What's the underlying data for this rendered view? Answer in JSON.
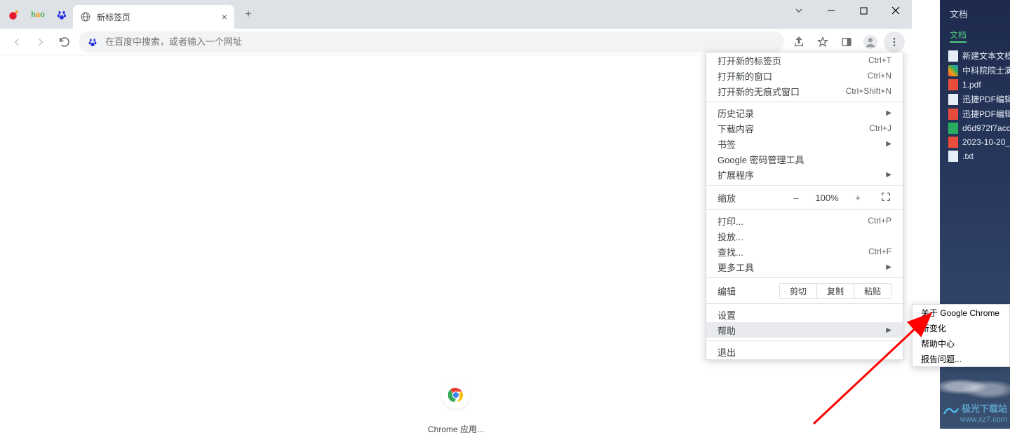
{
  "tab": {
    "title": "新标签页"
  },
  "omnibox": {
    "placeholder": "在百度中搜索，或者输入一个网址"
  },
  "content": {
    "apps_label": "Chrome 应用..."
  },
  "menu": {
    "new_tab": {
      "label": "打开新的标签页",
      "shortcut": "Ctrl+T"
    },
    "new_window": {
      "label": "打开新的窗口",
      "shortcut": "Ctrl+N"
    },
    "incognito": {
      "label": "打开新的无痕式窗口",
      "shortcut": "Ctrl+Shift+N"
    },
    "history": {
      "label": "历史记录"
    },
    "downloads": {
      "label": "下载内容",
      "shortcut": "Ctrl+J"
    },
    "bookmarks": {
      "label": "书签"
    },
    "passwords": {
      "label": "Google 密码管理工具"
    },
    "extensions": {
      "label": "扩展程序"
    },
    "zoom": {
      "label": "缩放",
      "minus": "–",
      "pct": "100%",
      "plus": "+"
    },
    "print": {
      "label": "打印...",
      "shortcut": "Ctrl+P"
    },
    "cast": {
      "label": "投放..."
    },
    "find": {
      "label": "查找...",
      "shortcut": "Ctrl+F"
    },
    "more_tools": {
      "label": "更多工具"
    },
    "edit": {
      "label": "编辑",
      "cut": "剪切",
      "copy": "复制",
      "paste": "粘贴"
    },
    "settings": {
      "label": "设置"
    },
    "help": {
      "label": "帮助"
    },
    "exit": {
      "label": "退出"
    }
  },
  "help_submenu": {
    "about": "关于 Google Chrome",
    "whatsnew": "新变化",
    "help_center": "帮助中心",
    "report": "报告问题..."
  },
  "docs": {
    "title": "文档",
    "tab": "文档",
    "files": [
      {
        "name": "新建文本文档",
        "type": "doc"
      },
      {
        "name": "中科院院士演",
        "type": "rainbow"
      },
      {
        "name": "1.pdf",
        "type": "pdf"
      },
      {
        "name": "迅捷PDF编辑",
        "type": "doc"
      },
      {
        "name": "迅捷PDF编辑",
        "type": "pdf"
      },
      {
        "name": "d6d972f7acc",
        "type": "sheet"
      },
      {
        "name": "2023-10-20_",
        "type": "pdf"
      },
      {
        "name": ".txt",
        "type": "doc"
      }
    ]
  },
  "watermark": {
    "brand": "极光下载站",
    "url": "www.xz7.com"
  }
}
